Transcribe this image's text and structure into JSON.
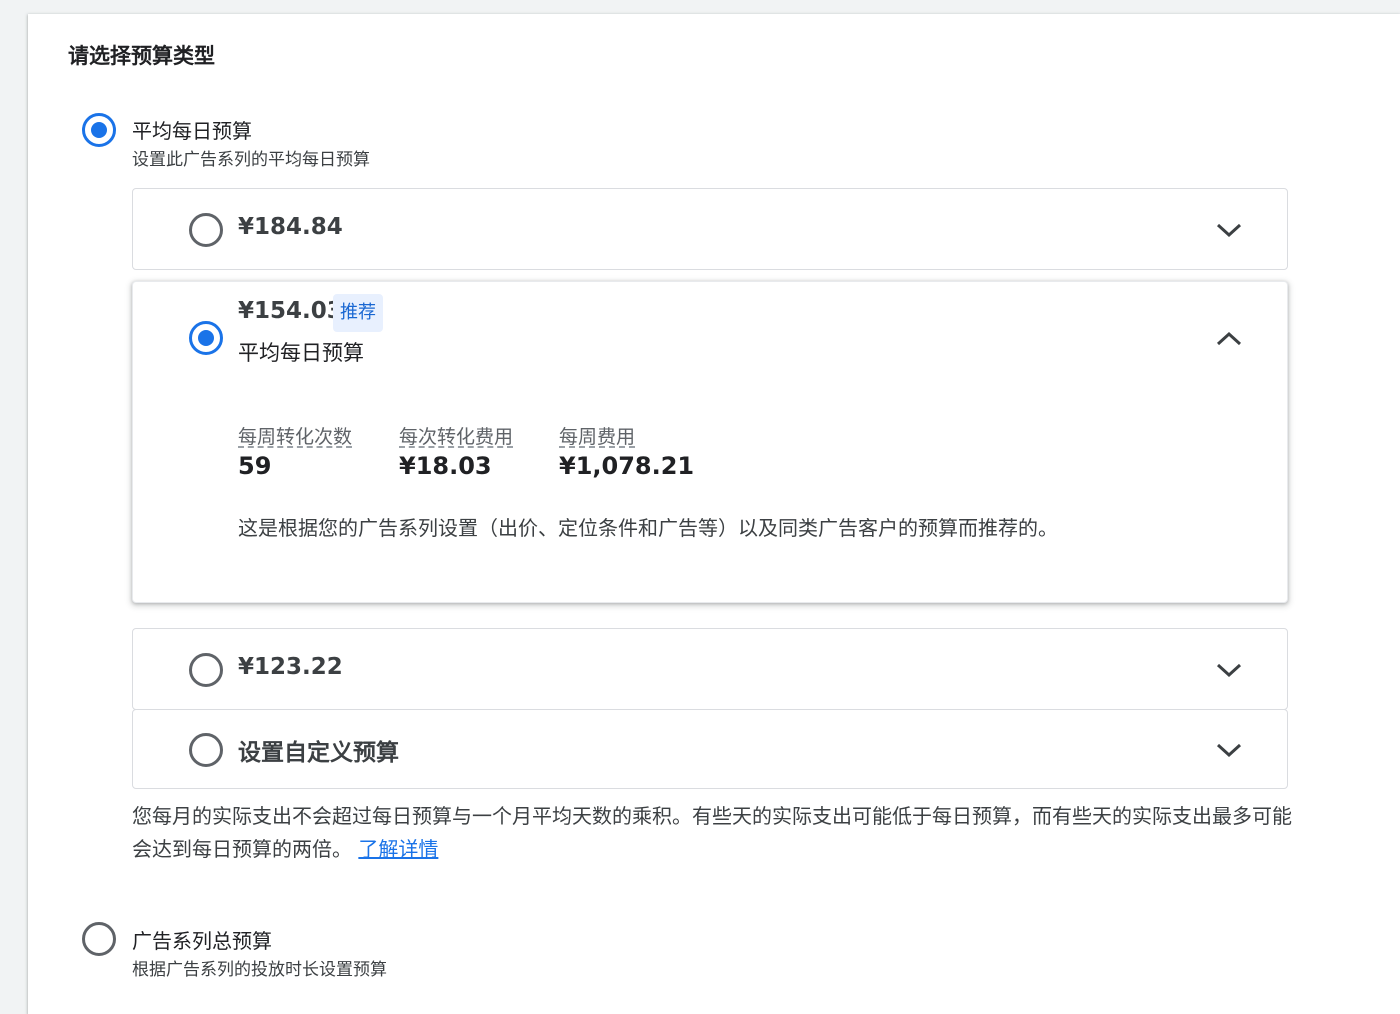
{
  "section_title": "请选择预算类型",
  "budget_types": {
    "average_daily": {
      "label": "平均每日预算",
      "description": "设置此广告系列的平均每日预算",
      "selected": true
    },
    "campaign_total": {
      "label": "广告系列总预算",
      "description": "根据广告系列的投放时长设置预算",
      "selected": false
    }
  },
  "options": {
    "opt1": {
      "amount": "¥184.84",
      "selected": false
    },
    "opt2": {
      "amount": "¥154.03",
      "badge": "推荐",
      "subtitle": "平均每日预算",
      "selected": true,
      "metrics": [
        {
          "label": "每周转化次数",
          "value": "59"
        },
        {
          "label": "每次转化费用",
          "value": "¥18.03"
        },
        {
          "label": "每周费用",
          "value": "¥1,078.21"
        }
      ],
      "recommendation": "这是根据您的广告系列设置（出价、定位条件和广告等）以及同类广告客户的预算而推荐的。"
    },
    "opt3": {
      "amount": "¥123.22",
      "selected": false
    },
    "custom": {
      "label": "设置自定义预算",
      "selected": false
    }
  },
  "note": {
    "text": "您每月的实际支出不会超过每日预算与一个月平均天数的乘积。有些天的实际支出可能低于每日预算，而有些天的实际支出最多可能会达到每日预算的两倍。 ",
    "link": "了解详情"
  },
  "icons": {
    "chevron_down": "chevron-down-icon",
    "chevron_up": "chevron-up-icon"
  },
  "colors": {
    "accent": "#1a73e8",
    "badge_bg": "#e8f0fe",
    "badge_text": "#1967d2"
  }
}
